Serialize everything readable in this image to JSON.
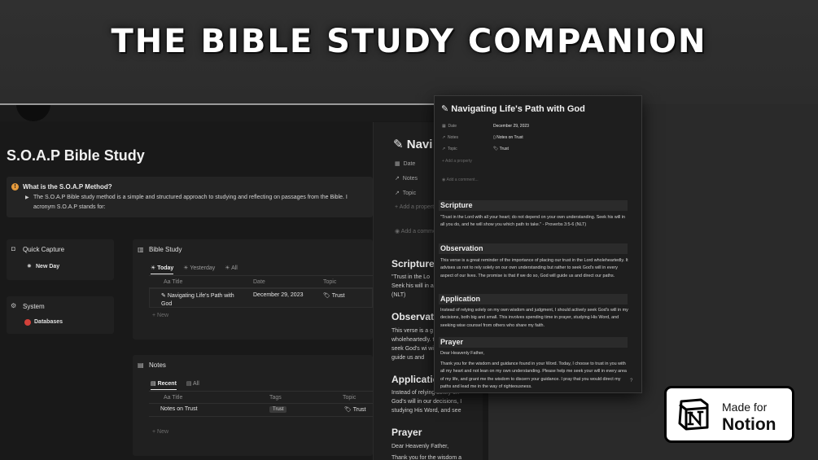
{
  "headline": "THE BIBLE STUDY COMPANION",
  "page": {
    "title": "S.O.A.P Bible Study",
    "callout": {
      "title": "What is the S.O.A.P Method?",
      "text": "The S.O.A.P Bible study method is a simple and structured approach to studying and reflecting on passages from the Bible. I acronym S.O.A.P stands for:"
    },
    "quick_capture": {
      "title": "Quick Capture",
      "button": "New Day"
    },
    "system": {
      "title": "System",
      "button": "Databases"
    }
  },
  "bible_study_db": {
    "title": "Bible Study",
    "tabs": [
      "Today",
      "Yesterday",
      "All"
    ],
    "columns": [
      "Aa Title",
      "Date",
      "Topic"
    ],
    "rows": [
      {
        "title": "Navigating Life's Path with God",
        "date": "December 29, 2023",
        "topic": "Trust"
      }
    ],
    "new_label": "+ New"
  },
  "notes_db": {
    "title": "Notes",
    "tabs": [
      "Recent",
      "All"
    ],
    "columns": [
      "Aa Title",
      "Tags",
      "Topic"
    ],
    "rows": [
      {
        "title": "Notes on Trust",
        "tag": "Trust",
        "topic": "Trust"
      }
    ],
    "new_label": "+ New"
  },
  "back_panel": {
    "title": "Navi",
    "props": [
      "Date",
      "Notes",
      "Topic",
      "+ Add a propert",
      "Add a comme"
    ],
    "scripture_head": "Scripture",
    "scripture_text": "\"Trust in the Lo Seek his will in a (NLT)",
    "observation_head": "Observatio",
    "observation_text": "This verse is a g wholeheartedly. to seek God's wi will guide us and",
    "application_head": "Applicatio",
    "application_text": "Instead of relying solely on God's will in our decisions, I studying His Word, and see",
    "prayer_head": "Prayer",
    "prayer_text": "Dear Heavenly Father,",
    "prayer_text2": "Thank you for the wisdom a"
  },
  "detail": {
    "title": "Navigating Life's Path with God",
    "props": [
      {
        "key": "Date",
        "value": "December 29, 2023"
      },
      {
        "key": "Notes",
        "value": "Notes on Trust"
      },
      {
        "key": "Topic",
        "value": "Trust"
      }
    ],
    "add_property": "+ Add a property",
    "add_comment": "Add a comment...",
    "scripture_head": "Scripture",
    "scripture_text": "\"Trust in the Lord with all your heart; do not depend on your own understanding. Seek his will in all you do, and he will show you which path to take.\" - Proverbs 3:5-6 (NLT)",
    "observation_head": "Observation",
    "observation_text": "This verse is a great reminder of the importance of placing our trust in the Lord wholeheartedly. It advises us not to rely solely on our own understanding but rather to seek God's will in every aspect of our lives. The promise is that if we do so, God will guide us and direct our paths.",
    "application_head": "Application",
    "application_text": "Instead of relying solely on my own wisdom and judgment, I should actively seek God's will in my decisions, both big and small. This involves spending time in prayer, studying His Word, and seeking wise counsel from others who share my faith.",
    "prayer_head": "Prayer",
    "prayer_salutation": "Dear Heavenly Father,",
    "prayer_text": "Thank you for the wisdom and guidance found in your Word. Today, I choose to trust in you with all my heart and not lean on my own understanding. Please help me seek your will in every area of my life, and grant me the wisdom to discern your guidance. I pray that you would direct my paths and lead me in the way of righteousness.",
    "help": "?"
  },
  "badge": {
    "made_for": "Made for",
    "brand": "Notion"
  }
}
